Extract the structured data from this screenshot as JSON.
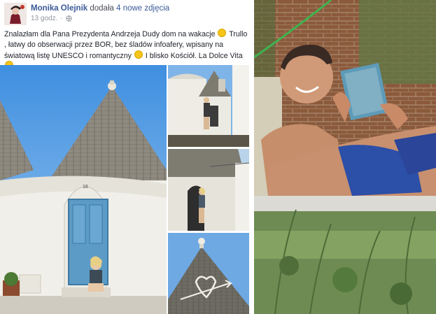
{
  "post": {
    "author": "Monika Olejnik",
    "action": "dodała",
    "action_object": "4 nowe zdjęcia",
    "time": "13 godz.",
    "privacy_icon": "globe-icon",
    "text_parts": [
      "Znalazłam dla Pana Prezydenta Andrzeja Dudy dom na wakacje",
      "Trullo , łatwy do obserwacji przez BOR, bez śladów infoafery, wpisany na światową listę UNESCO i romantyczny",
      "I blisko Kościół. La Dolce Vita"
    ],
    "emoticon": "smiley-icon",
    "door_number": "16"
  },
  "colors": {
    "link": "#3b5998",
    "sky": "#5aa0e3",
    "door": "#5b9bc6",
    "grass": "#7fa55a"
  }
}
